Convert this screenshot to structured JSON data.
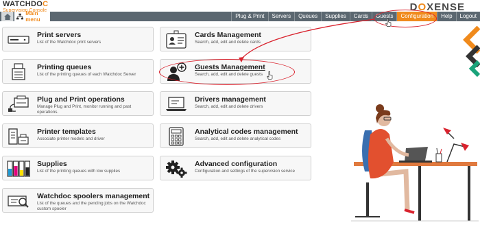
{
  "brand": {
    "name_prefix": "WATCHDO",
    "name_accent": "C",
    "subtitle": "Supervision Console"
  },
  "partner_logo": {
    "text_start": "D",
    "text_accent": "O",
    "text_end": "XENSE"
  },
  "main_menu": {
    "label": "Main menu",
    "home_icon": "home-icon",
    "menu_icon": "network-icon"
  },
  "nav": {
    "items": [
      {
        "label": "Plug & Print"
      },
      {
        "label": "Servers"
      },
      {
        "label": "Queues"
      },
      {
        "label": "Supplies"
      },
      {
        "label": "Cards"
      },
      {
        "label": "Guests"
      },
      {
        "label": "Configuration",
        "active": true
      },
      {
        "label": "Help"
      },
      {
        "label": "Logout"
      }
    ]
  },
  "cards": {
    "print_servers": {
      "title": "Print servers",
      "desc": "List of the Watchdoc print servers",
      "icon": "server-icon"
    },
    "printing_queues": {
      "title": "Printing queues",
      "desc": "List of the printing queues of each Watchdoc Server",
      "icon": "printer-icon"
    },
    "plug_print": {
      "title": "Plug and Print operations",
      "desc": "Manage Plug and Print, monitor running and past operations.",
      "icon": "plug-printer-icon"
    },
    "printer_templates": {
      "title": "Printer templates",
      "desc": "Associate printer models and driver",
      "icon": "template-printer-icon"
    },
    "supplies": {
      "title": "Supplies",
      "desc": "List of the printing queues with low supplies",
      "icon": "ink-cartridges-icon"
    },
    "spoolers": {
      "title": "Watchdoc spoolers management",
      "desc": "List of the queues and the pending jobs on the Watchdoc custom spooler",
      "icon": "spooler-search-icon"
    },
    "cards_management": {
      "title": "Cards Management",
      "desc": "Search, add, edit and delete cards",
      "icon": "id-card-icon"
    },
    "guests_management": {
      "title": "Guests Management",
      "desc": "Search, add, edit and delete guests",
      "icon": "add-guest-icon"
    },
    "drivers_management": {
      "title": "Drivers management",
      "desc": "Search, add, edit and delete drivers",
      "icon": "laptop-icon"
    },
    "analytical_codes": {
      "title": "Analytical codes management",
      "desc": "Search, add, edit and delete analytical codes",
      "icon": "calculator-icon"
    },
    "advanced_config": {
      "title": "Advanced configuration",
      "desc": "Configuration and settings of the supervision service",
      "icon": "gears-icon"
    }
  },
  "colors": {
    "accent": "#f08a1c",
    "nav_bg": "#5b6770",
    "annotation": "#d9232e",
    "chevron_green": "#1aa37a"
  }
}
